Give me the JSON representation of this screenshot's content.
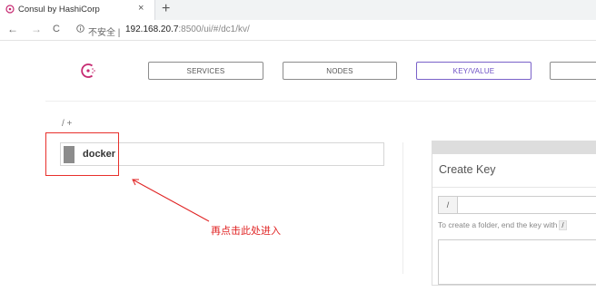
{
  "browser": {
    "tab_title": "Consul by HashiCorp",
    "tab_close": "×",
    "new_tab": "+",
    "back": "←",
    "forward": "→",
    "reload": "C",
    "insecure_label": "不安全 |",
    "url_host": "192.168.20.7",
    "url_rest": ":8500/ui/#/dc1/kv/"
  },
  "nav": {
    "services": "SERVICES",
    "nodes": "NODES",
    "keyvalue": "KEY/VALUE",
    "active": "keyvalue"
  },
  "kv": {
    "breadcrumb": "/ +",
    "items": [
      {
        "name": "docker"
      }
    ]
  },
  "annotation": {
    "text": "再点击此处进入",
    "color": "#e02222"
  },
  "create_key": {
    "title": "Create Key",
    "prefix": "/",
    "key_value": "",
    "help_text": "To create a folder, end the key with",
    "help_code": "/"
  },
  "colors": {
    "accent": "#6d4fc5",
    "highlight": "#e8302c"
  }
}
